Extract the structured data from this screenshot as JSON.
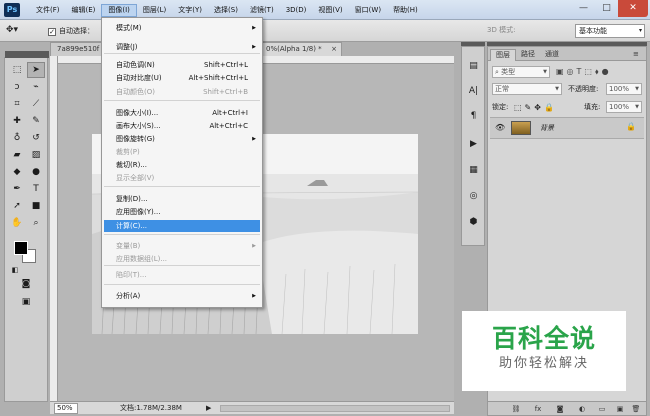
{
  "app": {
    "logo": "Ps"
  },
  "menubar": [
    "文件(F)",
    "编辑(E)",
    "图像(I)",
    "图层(L)",
    "文字(Y)",
    "选择(S)",
    "滤镜(T)",
    "3D(D)",
    "视图(V)",
    "窗口(W)",
    "帮助(H)"
  ],
  "window": {
    "minimize": "—",
    "maximize": "□",
    "close": "✕"
  },
  "options": {
    "auto_select_label": "自动选择：",
    "mode_label": "3D 模式:",
    "workspace": "基本功能"
  },
  "doc": {
    "tab1": "7a899e510f",
    "tab2": "0%(Alpha 1/8) *",
    "tab2_close": "×"
  },
  "image_menu": {
    "items": [
      {
        "label": "模式(M)",
        "shortcut": "",
        "submenu": true,
        "disabled": false
      },
      {
        "label": "调整(J)",
        "shortcut": "",
        "submenu": true,
        "disabled": false
      },
      {
        "label": "自动色调(N)",
        "shortcut": "Shift+Ctrl+L",
        "submenu": false,
        "disabled": false
      },
      {
        "label": "自动对比度(U)",
        "shortcut": "Alt+Shift+Ctrl+L",
        "submenu": false,
        "disabled": false
      },
      {
        "label": "自动颜色(O)",
        "shortcut": "Shift+Ctrl+B",
        "submenu": false,
        "disabled": true
      },
      {
        "label": "图像大小(I)...",
        "shortcut": "Alt+Ctrl+I",
        "submenu": false,
        "disabled": false
      },
      {
        "label": "画布大小(S)...",
        "shortcut": "Alt+Ctrl+C",
        "submenu": false,
        "disabled": false
      },
      {
        "label": "图像旋转(G)",
        "shortcut": "",
        "submenu": true,
        "disabled": false
      },
      {
        "label": "裁剪(P)",
        "shortcut": "",
        "submenu": false,
        "disabled": true
      },
      {
        "label": "裁切(R)...",
        "shortcut": "",
        "submenu": false,
        "disabled": false
      },
      {
        "label": "显示全部(V)",
        "shortcut": "",
        "submenu": false,
        "disabled": true
      },
      {
        "label": "复制(D)...",
        "shortcut": "",
        "submenu": false,
        "disabled": false
      },
      {
        "label": "应用图像(Y)...",
        "shortcut": "",
        "submenu": false,
        "disabled": false
      },
      {
        "label": "计算(C)...",
        "shortcut": "",
        "submenu": false,
        "disabled": false,
        "highlighted": true
      },
      {
        "label": "变量(B)",
        "shortcut": "",
        "submenu": true,
        "disabled": true
      },
      {
        "label": "应用数据组(L)...",
        "shortcut": "",
        "submenu": false,
        "disabled": true
      },
      {
        "label": "陷印(T)...",
        "shortcut": "",
        "submenu": false,
        "disabled": true
      },
      {
        "label": "分析(A)",
        "shortcut": "",
        "submenu": true,
        "disabled": false
      }
    ]
  },
  "layers_panel": {
    "tabs": [
      "图层",
      "路径",
      "通道"
    ],
    "filter": "类型",
    "blend_mode": "正常",
    "opacity_label": "不透明度:",
    "opacity_value": "100%",
    "lock_label": "锁定:",
    "fill_label": "填充:",
    "fill_value": "100%",
    "layer_name": "背景"
  },
  "status": {
    "zoom": "50%",
    "doc_info": "文档:1.78M/2.38M",
    "arrow": "▶"
  },
  "watermark": {
    "title": "百科全说",
    "subtitle": "助你轻松解决"
  },
  "colors": {
    "menu_highlight": "#3e90e4",
    "watermark_green": "#2aa44a"
  }
}
